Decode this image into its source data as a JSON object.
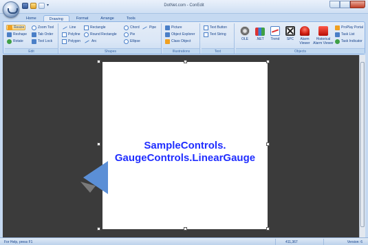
{
  "window": {
    "title": "DotNet.com - ConEdit"
  },
  "ribbon": {
    "tabs": [
      "Home",
      "Drawing",
      "Format",
      "Arrange",
      "Tools"
    ],
    "active_tab": "Drawing",
    "groups": {
      "edit": {
        "label": "Edit",
        "buttons": [
          "Resize",
          "Zoom Tool",
          "Reshape",
          "Tab Order",
          "Rotate",
          "Tool Lock"
        ]
      },
      "shapes": {
        "label": "Shapes",
        "buttons": [
          "Line",
          "Rectangle",
          "Chord",
          "Pipe",
          "Polyline",
          "Round Rectangle",
          "Pie",
          "Polygon",
          "Arc",
          "Ellipse"
        ]
      },
      "illustrations": {
        "label": "Illustrations",
        "buttons": [
          "Picture",
          "Object Explorer",
          "Class Object"
        ]
      },
      "text": {
        "label": "Text",
        "buttons": [
          "Text Button",
          "Text String"
        ]
      },
      "objects": {
        "label": "Objects",
        "big_buttons": [
          "OLE",
          ".NET",
          "Trend",
          "SPC",
          "Alarm Viewer",
          "Historical Alarm Viewer"
        ],
        "small_buttons": [
          "ProPlay Portal",
          "Task List",
          "Task Indicator"
        ]
      }
    }
  },
  "canvas": {
    "gauge_label_line1": "SampleControls.",
    "gauge_label_line2": "GaugeControls.LinearGauge",
    "label_color": "#1f2dff",
    "pointer_color": "#5b8fd6"
  },
  "status": {
    "help": "For Help, press F1",
    "coords": "411,367",
    "version": "Version: 6"
  }
}
